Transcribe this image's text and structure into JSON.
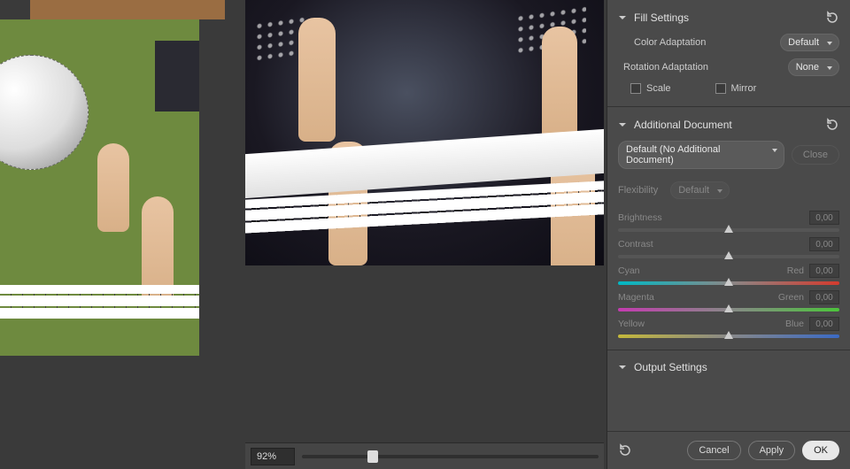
{
  "zoom": {
    "value": "92%"
  },
  "panel": {
    "fill": {
      "title": "Fill Settings",
      "color_adaptation_label": "Color Adaptation",
      "color_adaptation_value": "Default",
      "rotation_adaptation_label": "Rotation Adaptation",
      "rotation_adaptation_value": "None",
      "scale_label": "Scale",
      "mirror_label": "Mirror"
    },
    "additional": {
      "title": "Additional Document",
      "doc_value": "Default (No Additional Document)",
      "close_label": "Close",
      "flexibility_label": "Flexibility",
      "flexibility_value": "Default",
      "brightness_label": "Brightness",
      "brightness_value": "0,00",
      "contrast_label": "Contrast",
      "contrast_value": "0,00",
      "cyan_label": "Cyan",
      "red_label": "Red",
      "cr_value": "0,00",
      "magenta_label": "Magenta",
      "green_label": "Green",
      "mg_value": "0,00",
      "yellow_label": "Yellow",
      "blue_label": "Blue",
      "yb_value": "0,00"
    },
    "output": {
      "title": "Output Settings"
    },
    "footer": {
      "cancel": "Cancel",
      "apply": "Apply",
      "ok": "OK"
    }
  }
}
